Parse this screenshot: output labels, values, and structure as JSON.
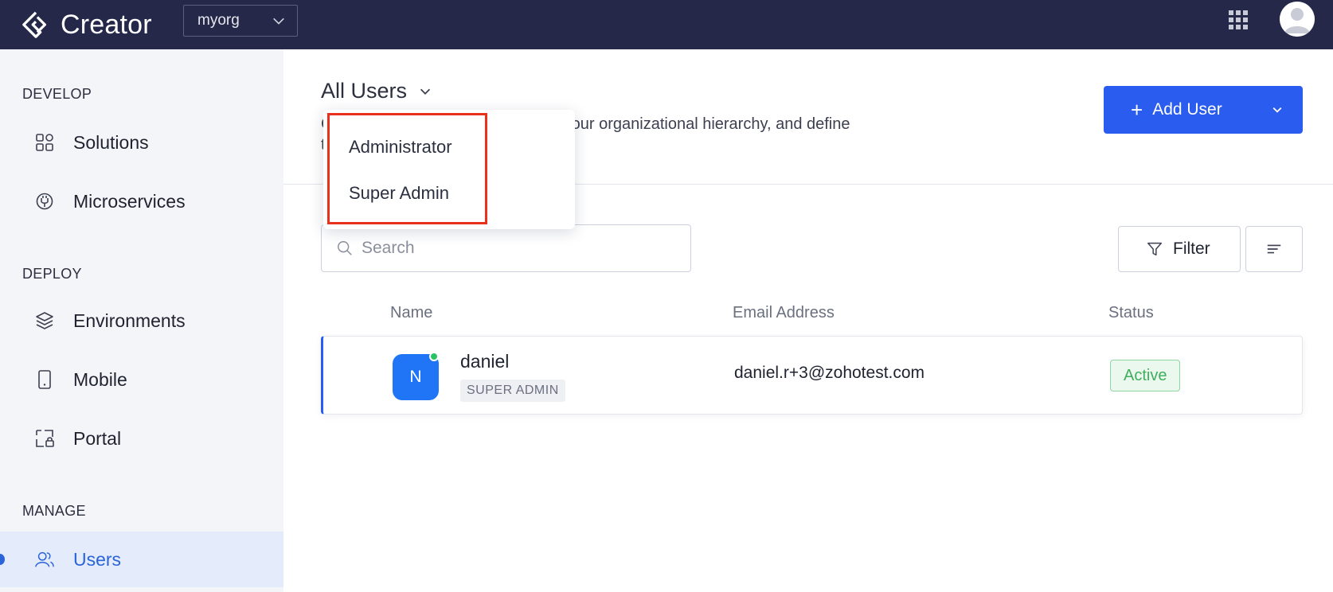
{
  "app": {
    "title": "Creator",
    "org": "myorg"
  },
  "sidebar": {
    "sections": [
      {
        "title": "DEVELOP"
      },
      {
        "title": "DEPLOY"
      },
      {
        "title": "MANAGE"
      }
    ],
    "items": [
      {
        "label": "Solutions",
        "icon": "grid-shapes-icon"
      },
      {
        "label": "Microservices",
        "icon": "plug-icon"
      },
      {
        "label": "Environments",
        "icon": "layers-icon"
      },
      {
        "label": "Mobile",
        "icon": "mobile-icon"
      },
      {
        "label": "Portal",
        "icon": "portal-lock-icon"
      },
      {
        "label": "Users",
        "icon": "users-icon",
        "active": true
      }
    ]
  },
  "main": {
    "title": "All Users",
    "description_line1": "Create and assign roles based on your organizational hierarchy, and define",
    "description_line2": "their application access.",
    "add_user_label": "Add User",
    "search_placeholder": "Search",
    "filter_label": "Filter",
    "columns": [
      "Name",
      "Email Address",
      "Status"
    ],
    "users": [
      {
        "initial": "N",
        "name": "daniel",
        "role": "SUPER ADMIN",
        "email": "daniel.r+3@zohotest.com",
        "status": "Active"
      }
    ]
  },
  "dropdown": {
    "items": [
      "Administrator",
      "Super Admin"
    ]
  },
  "colors": {
    "topbar": "#252849",
    "accent": "#2a5cf0",
    "active_green": "#3fae5d",
    "highlight": "#e8301c"
  }
}
